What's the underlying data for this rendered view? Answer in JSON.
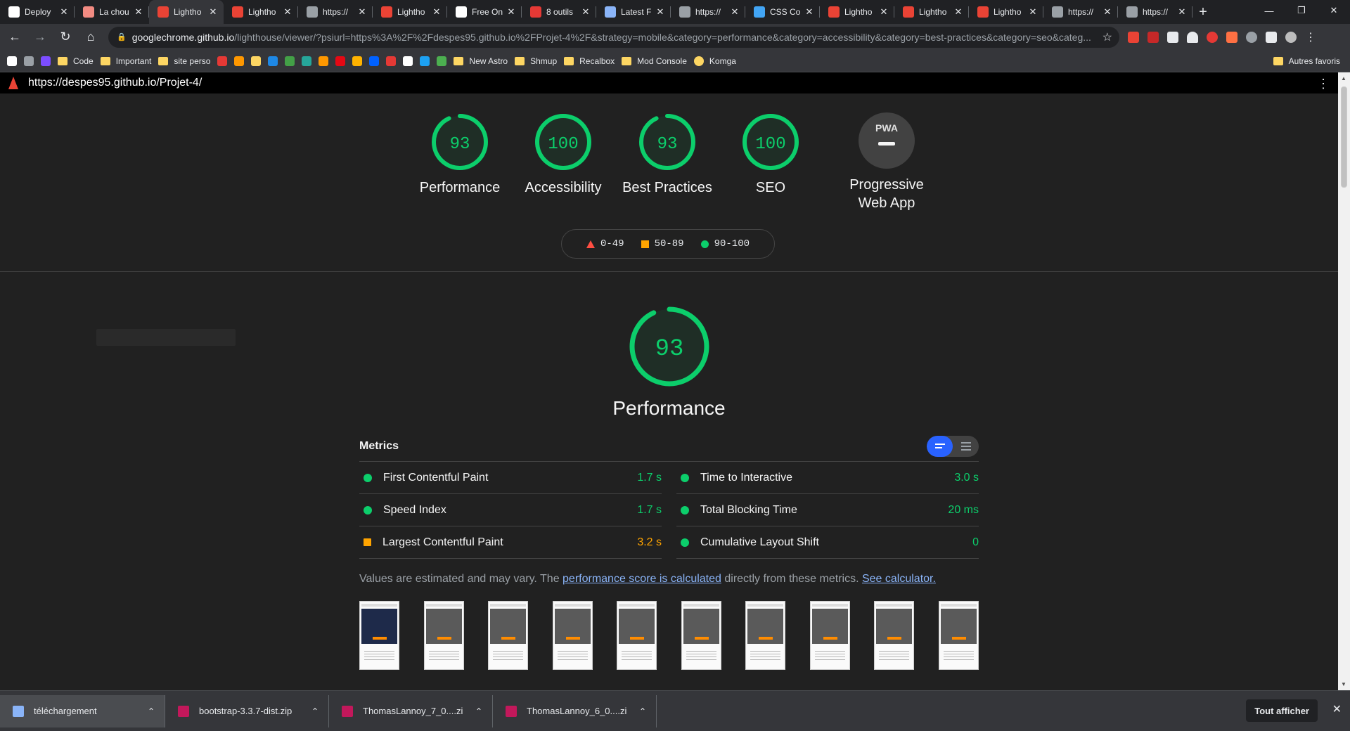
{
  "tabs": [
    {
      "title": "Deploy",
      "icon": "github-icon",
      "color": "#ffffff"
    },
    {
      "title": "La chou",
      "icon": "site-icon",
      "color": "#f28b82"
    },
    {
      "title": "Lightho",
      "icon": "lighthouse-icon",
      "color": "#ea4335",
      "active": true
    },
    {
      "title": "Lightho",
      "icon": "lighthouse-icon",
      "color": "#ea4335"
    },
    {
      "title": "https://",
      "icon": "globe-icon",
      "color": "#9aa0a6"
    },
    {
      "title": "Lightho",
      "icon": "lighthouse-icon",
      "color": "#ea4335"
    },
    {
      "title": "Free On",
      "icon": "ff-icon",
      "color": "#ffffff"
    },
    {
      "title": "8 outils",
      "icon": "g-icon",
      "color": "#e53935"
    },
    {
      "title": "Latest F",
      "icon": "terminal-icon",
      "color": "#8ab4f8"
    },
    {
      "title": "https://",
      "icon": "globe-icon",
      "color": "#9aa0a6"
    },
    {
      "title": "CSS Co",
      "icon": "css-icon",
      "color": "#42a5f5"
    },
    {
      "title": "Lightho",
      "icon": "lighthouse-icon",
      "color": "#ea4335"
    },
    {
      "title": "Lightho",
      "icon": "lighthouse-icon",
      "color": "#ea4335"
    },
    {
      "title": "Lightho",
      "icon": "lighthouse-icon",
      "color": "#ea4335"
    },
    {
      "title": "https://",
      "icon": "globe-icon",
      "color": "#9aa0a6"
    },
    {
      "title": "https://",
      "icon": "globe-icon",
      "color": "#9aa0a6"
    }
  ],
  "address": {
    "host": "googlechrome.github.io",
    "path": "/lighthouse/viewer/?psiurl=https%3A%2F%2Fdespes95.github.io%2FProjet-4%2F&strategy=mobile&category=performance&category=accessibility&category=best-practices&category=seo&categ..."
  },
  "bookmarks": {
    "items": [
      {
        "label": "",
        "type": "icon",
        "color": "#ffffff"
      },
      {
        "label": "",
        "type": "icon",
        "color": "#9aa0a6"
      },
      {
        "label": "",
        "type": "icon",
        "color": "#7c4dff"
      },
      {
        "label": "Code",
        "type": "folder"
      },
      {
        "label": "Important",
        "type": "folder"
      },
      {
        "label": "site perso",
        "type": "folder"
      },
      {
        "label": "",
        "type": "icon",
        "color": "#e53935"
      },
      {
        "label": "",
        "type": "icon",
        "color": "#ff9800"
      },
      {
        "label": "",
        "type": "icon",
        "color": "#fdd663"
      },
      {
        "label": "",
        "type": "icon",
        "color": "#1e88e5"
      },
      {
        "label": "",
        "type": "icon",
        "color": "#43a047"
      },
      {
        "label": "",
        "type": "icon",
        "color": "#26a69a"
      },
      {
        "label": "",
        "type": "icon",
        "color": "#ff9800"
      },
      {
        "label": "",
        "type": "icon",
        "color": "#e50914"
      },
      {
        "label": "",
        "type": "icon",
        "color": "#ffb300"
      },
      {
        "label": "",
        "type": "icon",
        "color": "#0061ff"
      },
      {
        "label": "",
        "type": "icon",
        "color": "#e53935"
      },
      {
        "label": "",
        "type": "icon",
        "color": "#ffffff"
      },
      {
        "label": "",
        "type": "icon",
        "color": "#1da1f2"
      },
      {
        "label": "",
        "type": "icon",
        "color": "#4caf50"
      },
      {
        "label": "New Astro",
        "type": "folder"
      },
      {
        "label": "Shmup",
        "type": "folder"
      },
      {
        "label": "Recalbox",
        "type": "folder"
      },
      {
        "label": "Mod Console",
        "type": "folder"
      },
      {
        "label": "Komga",
        "type": "site"
      }
    ],
    "other": "Autres favoris"
  },
  "page_header": {
    "url": "https://despes95.github.io/Projet-4/"
  },
  "gauges": [
    {
      "score": "93",
      "label": "Performance",
      "color": "#0cce6b",
      "fraction": 0.93
    },
    {
      "score": "100",
      "label": "Accessibility",
      "color": "#0cce6b",
      "fraction": 1.0
    },
    {
      "score": "93",
      "label": "Best Practices",
      "color": "#0cce6b",
      "fraction": 0.93
    },
    {
      "score": "100",
      "label": "SEO",
      "color": "#0cce6b",
      "fraction": 1.0
    }
  ],
  "pwa": {
    "badge": "PWA",
    "label_line1": "Progressive",
    "label_line2": "Web App"
  },
  "legend": {
    "fail": "0-49",
    "average": "50-89",
    "pass": "90-100"
  },
  "performance": {
    "score": "93",
    "fraction": 0.93,
    "title": "Performance"
  },
  "metrics": {
    "title": "Metrics",
    "left": [
      {
        "name": "First Contentful Paint",
        "value": "1.7 s",
        "status": "pass"
      },
      {
        "name": "Speed Index",
        "value": "1.7 s",
        "status": "pass"
      },
      {
        "name": "Largest Contentful Paint",
        "value": "3.2 s",
        "status": "average"
      }
    ],
    "right": [
      {
        "name": "Time to Interactive",
        "value": "3.0 s",
        "status": "pass"
      },
      {
        "name": "Total Blocking Time",
        "value": "20 ms",
        "status": "pass"
      },
      {
        "name": "Cumulative Layout Shift",
        "value": "0",
        "status": "pass"
      }
    ],
    "note_prefix": "Values are estimated and may vary. The ",
    "note_link1": "performance score is calculated",
    "note_middle": " directly from these metrics. ",
    "note_link2": "See calculator."
  },
  "filmstrip_count": 10,
  "downloads": {
    "items": [
      {
        "name": "téléchargement",
        "color": "#8ab4f8"
      },
      {
        "name": "bootstrap-3.3.7-dist.zip",
        "color": "#c2185b"
      },
      {
        "name": "ThomasLannoy_7_0....zi",
        "color": "#c2185b"
      },
      {
        "name": "ThomasLannoy_6_0....zi",
        "color": "#c2185b"
      }
    ],
    "show_all": "Tout afficher"
  },
  "colors": {
    "pass": "#0cce6b",
    "average": "#ffa400",
    "fail": "#ff4e42",
    "link": "#8ab4f8"
  }
}
